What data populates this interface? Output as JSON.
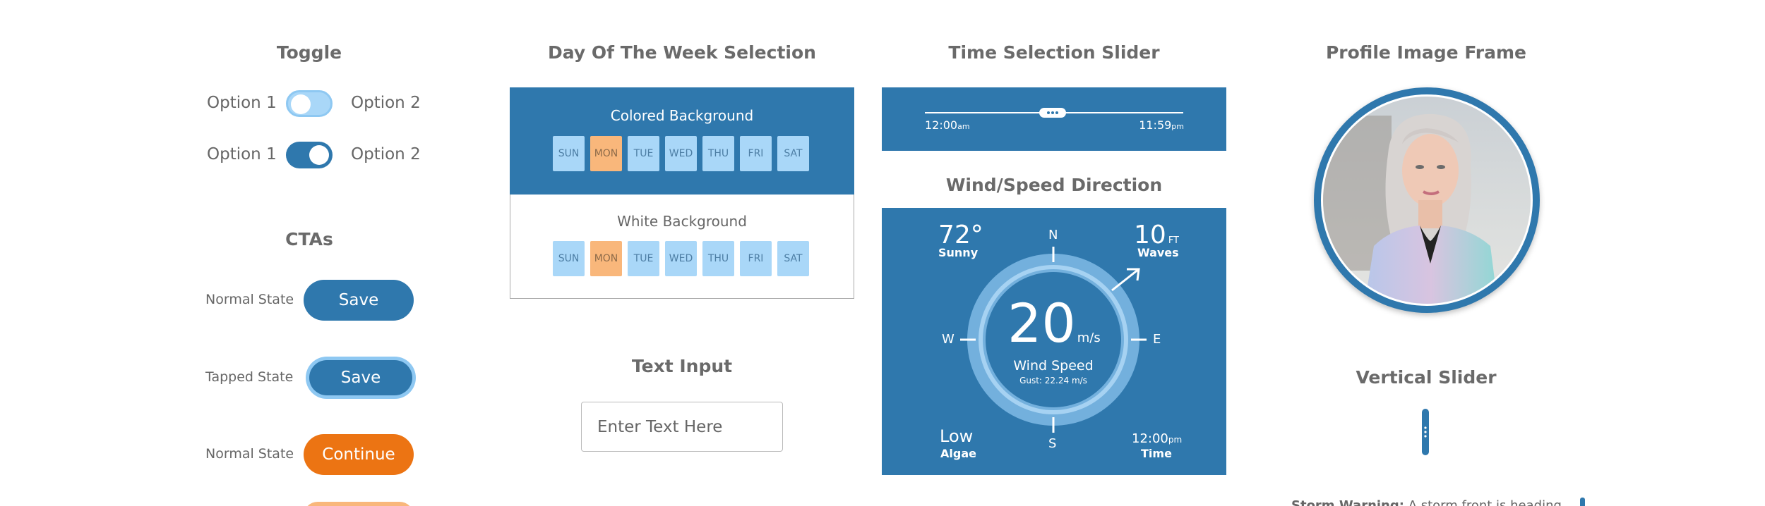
{
  "toggle": {
    "title": "Toggle",
    "rows": [
      {
        "left": "Option 1",
        "right": "Option 2",
        "state": "off"
      },
      {
        "left": "Option 1",
        "right": "Option 2",
        "state": "on"
      }
    ]
  },
  "ctas": {
    "title": "CTAs",
    "rows": [
      {
        "state_label": "Normal State",
        "button": "Save"
      },
      {
        "state_label": "Tapped State",
        "button": "Save"
      },
      {
        "state_label": "Normal State",
        "button": "Continue"
      }
    ]
  },
  "day_selection": {
    "title": "Day Of The Week Selection",
    "colored_heading": "Colored Background",
    "white_heading": "White Background",
    "days": [
      "SUN",
      "MON",
      "TUE",
      "WED",
      "THU",
      "FRI",
      "SAT"
    ],
    "selected": "MON"
  },
  "text_input": {
    "title": "Text Input",
    "placeholder": "Enter Text Here",
    "value": ""
  },
  "time_slider": {
    "title": "Time Selection Slider",
    "start_time": "12:00",
    "start_suffix": "am",
    "end_time": "11:59",
    "end_suffix": "pm"
  },
  "wind": {
    "title": "Wind/Speed Direction",
    "temperature": "72°",
    "temperature_label": "Sunny",
    "waves_value": "10",
    "waves_unit": "FT",
    "waves_label": "Waves",
    "compass": {
      "n": "N",
      "e": "E",
      "s": "S",
      "w": "W"
    },
    "speed": "20",
    "speed_unit": "m/s",
    "speed_label": "Wind Speed",
    "gust": "Gust: 22.24 m/s",
    "algae_value": "Low",
    "algae_label": "Algae",
    "time_value": "12:00",
    "time_suffix": "pm",
    "time_label": "Time"
  },
  "profile": {
    "title": "Profile Image Frame"
  },
  "vertical_slider": {
    "title": "Vertical Slider"
  },
  "storm": {
    "label": "Storm Warning:",
    "text": "A storm front is heading"
  },
  "colors": {
    "primary_blue": "#2f78ad",
    "light_blue": "#a9d7f8",
    "orange": "#ec7413",
    "selected_day": "#f9b77b"
  }
}
